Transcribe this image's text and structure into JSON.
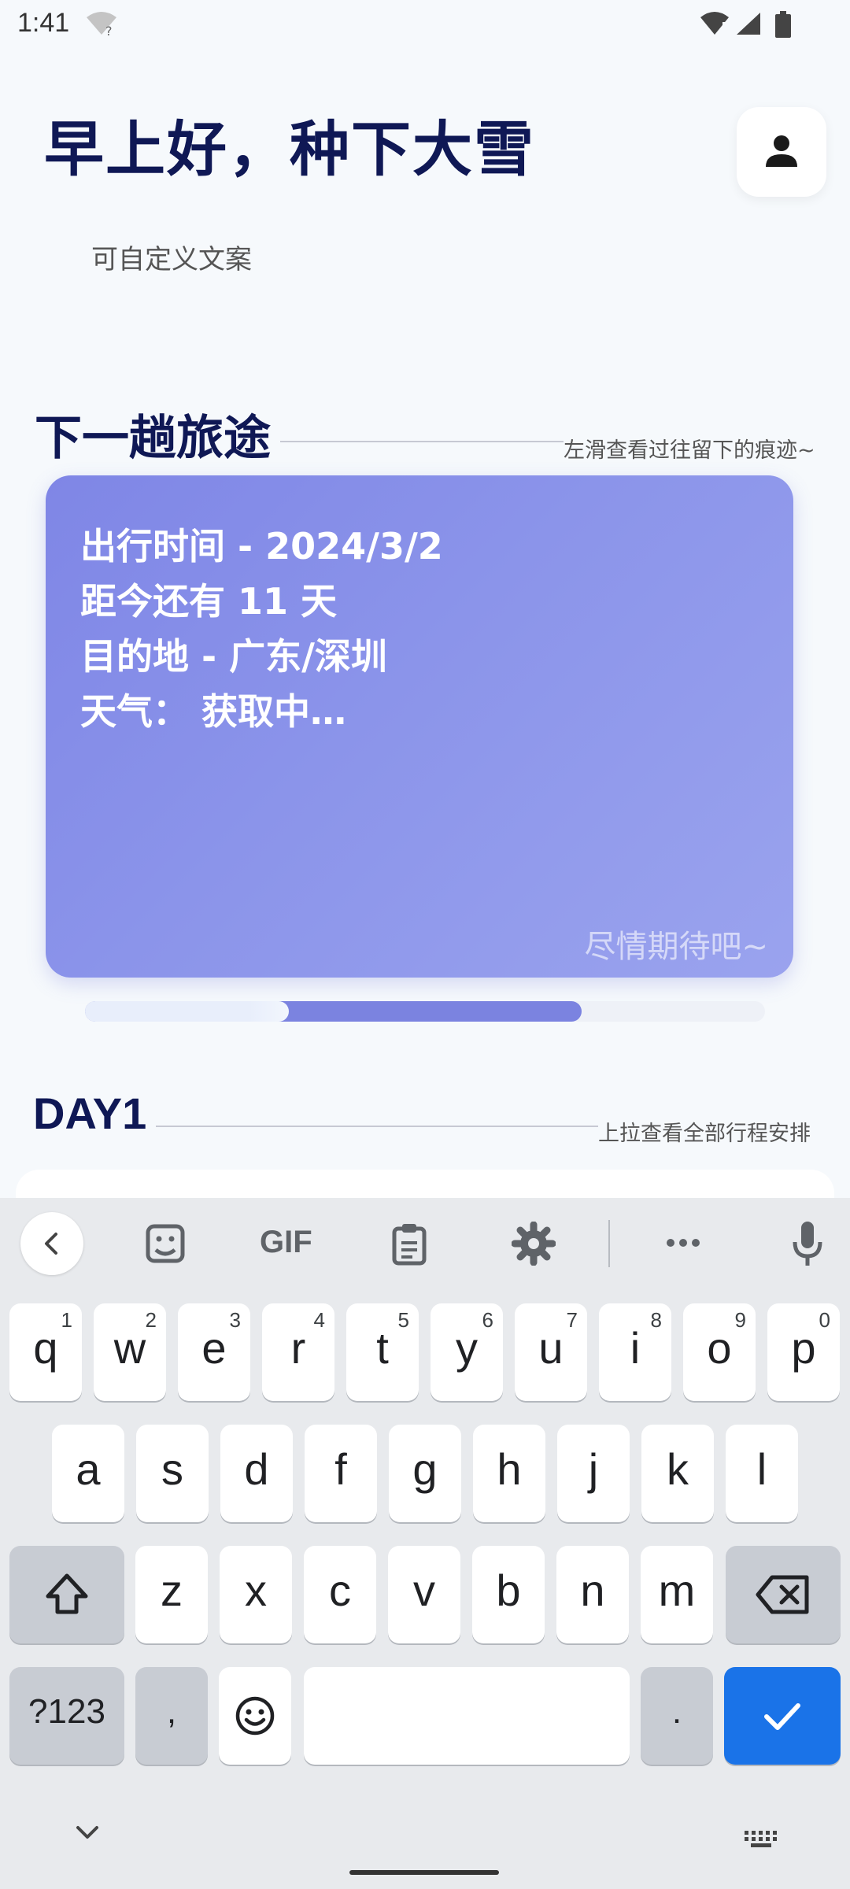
{
  "status_bar": {
    "time": "1:41"
  },
  "header": {
    "greeting": "早上好，种下大雪",
    "subtitle": "可自定义文案"
  },
  "next_trip": {
    "title": "下一趟旅途",
    "hint": "左滑查看过往留下的痕迹~",
    "card": {
      "line1": "出行时间 - 2024/3/2",
      "line2": "距今还有 11 天",
      "line3": "目的地 - 广东/深圳",
      "line4": "天气： 获取中…",
      "footer": "尽情期待吧~"
    },
    "carousel_progress": 0.73
  },
  "day_section": {
    "title": "DAY1",
    "hint": "上拉查看全部行程安排"
  },
  "keyboard": {
    "toolbar": [
      "back",
      "sticker",
      "gif",
      "clipboard",
      "settings",
      "more",
      "microphone"
    ],
    "gif_label": "GIF",
    "row1": [
      {
        "k": "q",
        "n": "1"
      },
      {
        "k": "w",
        "n": "2"
      },
      {
        "k": "e",
        "n": "3"
      },
      {
        "k": "r",
        "n": "4"
      },
      {
        "k": "t",
        "n": "5"
      },
      {
        "k": "y",
        "n": "6"
      },
      {
        "k": "u",
        "n": "7"
      },
      {
        "k": "i",
        "n": "8"
      },
      {
        "k": "o",
        "n": "9"
      },
      {
        "k": "p",
        "n": "0"
      }
    ],
    "row2": [
      "a",
      "s",
      "d",
      "f",
      "g",
      "h",
      "j",
      "k",
      "l"
    ],
    "row3": [
      "z",
      "x",
      "c",
      "v",
      "b",
      "n",
      "m"
    ],
    "symbols_label": "?123",
    "comma_label": ",",
    "period_label": ".",
    "accent_color": "#1a73e8"
  }
}
